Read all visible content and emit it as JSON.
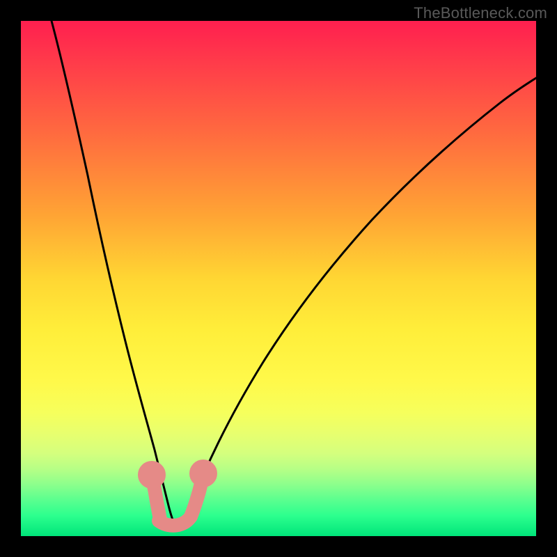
{
  "watermark": "TheBottleneck.com",
  "chart_data": {
    "type": "line",
    "title": "",
    "xlabel": "",
    "ylabel": "",
    "xlim": [
      0,
      100
    ],
    "ylim": [
      0,
      100
    ],
    "series": [
      {
        "name": "bottleneck-curve",
        "x": [
          6,
          8,
          10,
          12,
          14,
          16,
          18,
          20,
          22,
          24,
          25,
          26,
          27,
          28,
          29.5,
          31,
          33,
          36,
          40,
          45,
          50,
          56,
          63,
          72,
          82,
          94,
          100
        ],
        "y": [
          100,
          90,
          80,
          70,
          60,
          50,
          41,
          32,
          24,
          16,
          12,
          8,
          5,
          3,
          2,
          3,
          6,
          12,
          20,
          30,
          39,
          48,
          56,
          64,
          72,
          79,
          82
        ]
      },
      {
        "name": "highlight-band",
        "x": [
          25,
          26,
          27,
          28,
          29.5,
          31
        ],
        "y": [
          12,
          8,
          5,
          3,
          2,
          6
        ]
      }
    ],
    "colors": {
      "curve": "#000000",
      "highlight": "#e58a87",
      "gradient_top": "#ff1f4f",
      "gradient_bottom": "#00e57a"
    }
  }
}
